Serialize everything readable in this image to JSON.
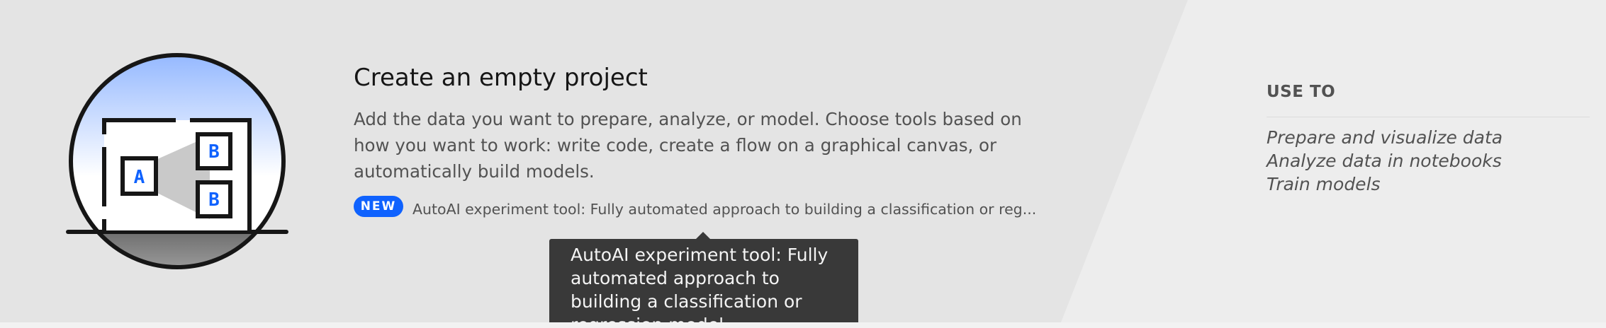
{
  "project_card": {
    "title": "Create an empty project",
    "description": "Add the data you want to prepare, analyze, or model. Choose tools based on how you want to work: write code, create a flow on a graphical canvas, or automatically build models.",
    "new_badge": "NEW",
    "new_feature_text": "AutoAI experiment tool: Fully automated approach to building a classification or reg...",
    "tooltip_text": "AutoAI experiment tool: Fully automated approach to building a classification or regression model",
    "illustration": {
      "label_a": "A",
      "label_b1": "B",
      "label_b2": "B"
    }
  },
  "use_to": {
    "heading": "USE TO",
    "items": [
      "Prepare and visualize data",
      "Analyze data in notebooks",
      "Train models"
    ]
  },
  "colors": {
    "card_background": "#e4e4e4",
    "right_panel_background": "#ededed",
    "accent_blue": "#0f62fe",
    "tooltip_background": "#393939",
    "title_text": "#161616",
    "body_text": "#525252"
  },
  "icons": {
    "illustration": "ab-testing-illustration"
  }
}
